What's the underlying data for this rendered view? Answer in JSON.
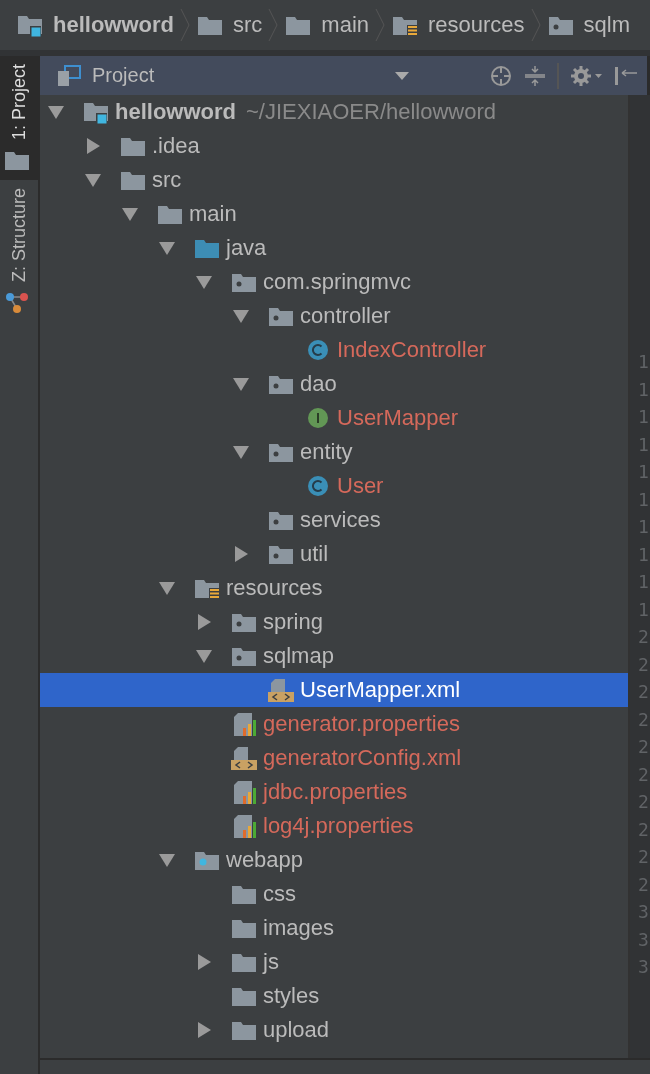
{
  "breadcrumbs": [
    {
      "label": "hellowword",
      "kind": "module",
      "bold": true
    },
    {
      "label": "src",
      "kind": "folder",
      "bold": false
    },
    {
      "label": "main",
      "kind": "folder",
      "bold": false
    },
    {
      "label": "resources",
      "kind": "resources",
      "bold": false
    },
    {
      "label": "sqlm",
      "kind": "package",
      "bold": false
    }
  ],
  "tool_strip": [
    {
      "label": "1: Project",
      "selected": true,
      "kind": "folder"
    },
    {
      "label": "Z: Structure",
      "selected": false,
      "kind": "structure"
    }
  ],
  "panel": {
    "title": "Project"
  },
  "tree": [
    {
      "label": "hellowword",
      "path": "~/JIEXIAOER/hellowword",
      "kind": "module",
      "expanded": true,
      "selected": false,
      "color": "#bbbbbb",
      "children": [
        {
          "label": ".idea",
          "kind": "folder",
          "expanded": false,
          "selected": false,
          "color": "#bbbbbb"
        },
        {
          "label": "src",
          "kind": "folder",
          "expanded": true,
          "selected": false,
          "color": "#bbbbbb",
          "children": [
            {
              "label": "main",
              "kind": "folder",
              "expanded": true,
              "selected": false,
              "color": "#bbbbbb",
              "children": [
                {
                  "label": "java",
                  "kind": "source",
                  "expanded": true,
                  "selected": false,
                  "color": "#bbbbbb",
                  "children": [
                    {
                      "label": "com.springmvc",
                      "kind": "package",
                      "expanded": true,
                      "selected": false,
                      "color": "#bbbbbb",
                      "children": [
                        {
                          "label": "controller",
                          "kind": "package",
                          "expanded": true,
                          "selected": false,
                          "color": "#bbbbbb",
                          "children": [
                            {
                              "label": "IndexController",
                              "kind": "class",
                              "selected": false,
                              "color": "#d5695b"
                            }
                          ]
                        },
                        {
                          "label": "dao",
                          "kind": "package",
                          "expanded": true,
                          "selected": false,
                          "color": "#bbbbbb",
                          "children": [
                            {
                              "label": "UserMapper",
                              "kind": "interface",
                              "selected": false,
                              "color": "#d5695b"
                            }
                          ]
                        },
                        {
                          "label": "entity",
                          "kind": "package",
                          "expanded": true,
                          "selected": false,
                          "color": "#bbbbbb",
                          "children": [
                            {
                              "label": "User",
                              "kind": "class",
                              "selected": false,
                              "color": "#d5695b"
                            }
                          ]
                        },
                        {
                          "label": "services",
                          "kind": "package",
                          "selected": false,
                          "color": "#bbbbbb"
                        },
                        {
                          "label": "util",
                          "kind": "package",
                          "expanded": false,
                          "selected": false,
                          "color": "#bbbbbb"
                        }
                      ]
                    }
                  ]
                },
                {
                  "label": "resources",
                  "kind": "resources",
                  "expanded": true,
                  "selected": false,
                  "color": "#bbbbbb",
                  "children": [
                    {
                      "label": "spring",
                      "kind": "package",
                      "expanded": false,
                      "selected": false,
                      "color": "#bbbbbb"
                    },
                    {
                      "label": "sqlmap",
                      "kind": "package",
                      "expanded": true,
                      "selected": false,
                      "color": "#bbbbbb",
                      "children": [
                        {
                          "label": "UserMapper.xml",
                          "kind": "xml",
                          "selected": true,
                          "color": "#ffffff"
                        }
                      ]
                    },
                    {
                      "label": "generator.properties",
                      "kind": "properties",
                      "selected": false,
                      "color": "#d5695b"
                    },
                    {
                      "label": "generatorConfig.xml",
                      "kind": "xml",
                      "selected": false,
                      "color": "#d5695b"
                    },
                    {
                      "label": "jdbc.properties",
                      "kind": "properties",
                      "selected": false,
                      "color": "#d5695b"
                    },
                    {
                      "label": "log4j.properties",
                      "kind": "properties",
                      "selected": false,
                      "color": "#d5695b"
                    }
                  ]
                },
                {
                  "label": "webapp",
                  "kind": "web",
                  "expanded": true,
                  "selected": false,
                  "color": "#bbbbbb",
                  "children": [
                    {
                      "label": "css",
                      "kind": "folder",
                      "selected": false,
                      "color": "#bbbbbb"
                    },
                    {
                      "label": "images",
                      "kind": "folder",
                      "selected": false,
                      "color": "#bbbbbb"
                    },
                    {
                      "label": "js",
                      "kind": "folder",
                      "expanded": false,
                      "selected": false,
                      "color": "#bbbbbb"
                    },
                    {
                      "label": "styles",
                      "kind": "folder",
                      "selected": false,
                      "color": "#bbbbbb"
                    },
                    {
                      "label": "upload",
                      "kind": "folder",
                      "expanded": false,
                      "selected": false,
                      "color": "#bbbbbb"
                    }
                  ]
                }
              ]
            }
          ]
        }
      ]
    }
  ],
  "line_numbers": [
    "1",
    "1",
    "1",
    "1",
    "1",
    "1",
    "1",
    "1",
    "1",
    "1",
    "2",
    "2",
    "2",
    "2",
    "2",
    "2",
    "2",
    "2",
    "2",
    "2",
    "3",
    "3",
    "3"
  ]
}
